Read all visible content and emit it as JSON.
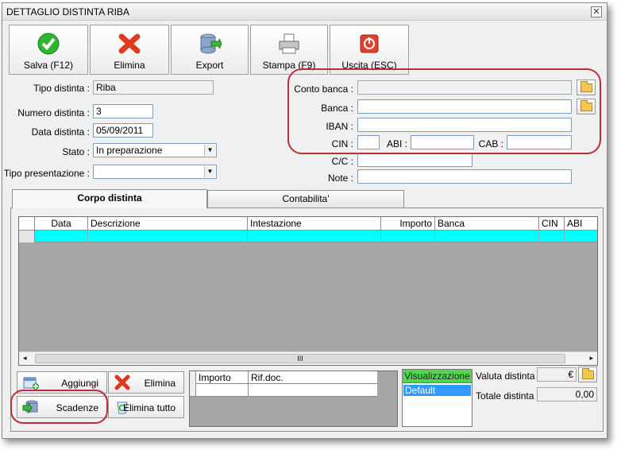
{
  "window": {
    "title": "DETTAGLIO DISTINTA RIBA",
    "close_glyph": "✕"
  },
  "toolbar": [
    {
      "label": "Salva (F12)",
      "icon": "check-icon"
    },
    {
      "label": "Elimina",
      "icon": "red-x-icon"
    },
    {
      "label": "Export",
      "icon": "export-icon"
    },
    {
      "label": "Stampa (F9)",
      "icon": "printer-icon"
    },
    {
      "label": "Uscita (ESC)",
      "icon": "power-icon"
    }
  ],
  "left_form": {
    "tipo_distinta": {
      "label": "Tipo distinta :",
      "value": "Riba"
    },
    "numero_distinta": {
      "label": "Numero distinta :",
      "value": "3"
    },
    "data_distinta": {
      "label": "Data distinta :",
      "value": "05/09/2011"
    },
    "stato": {
      "label": "Stato :",
      "value": "In preparazione"
    },
    "tipo_presentazione": {
      "label": "Tipo presentazione :",
      "value": ""
    }
  },
  "right_form": {
    "conto_banca": {
      "label": "Conto banca :",
      "value": ""
    },
    "banca": {
      "label": "Banca :",
      "value": ""
    },
    "iban": {
      "label": "IBAN :",
      "value": ""
    },
    "cin": {
      "label": "CIN :",
      "value": ""
    },
    "abi": {
      "label": "ABI :",
      "value": ""
    },
    "cab": {
      "label": "CAB :",
      "value": ""
    },
    "cc": {
      "label": "C/C :",
      "value": ""
    },
    "note": {
      "label": "Note :",
      "value": ""
    }
  },
  "tabs": [
    {
      "label": "Corpo distinta",
      "active": true
    },
    {
      "label": "Contabilita'",
      "active": false
    }
  ],
  "grid": {
    "columns": [
      "Data",
      "Descrizione",
      "Intestazione",
      "Importo",
      "Banca",
      "CIN",
      "ABI"
    ],
    "selected_row_color": "#00ffff",
    "scroll_thumb": "III"
  },
  "bottom_buttons": {
    "aggiungi": "Aggiungi",
    "elimina": "Elimina",
    "scadenze": "Scadenze",
    "elimina_tutto": "Elimina tutto"
  },
  "mini_grid": {
    "columns": [
      "Importo",
      "Rif.doc."
    ]
  },
  "visualizzazione": {
    "header": "Visualizzazione",
    "items": [
      "Default"
    ]
  },
  "totals": {
    "valuta_label": "Valuta distinta :",
    "valuta_value": "€",
    "totale_label": "Totale distinta :",
    "totale_value": "0,00"
  },
  "colors": {
    "highlight_ring": "#b9303a",
    "selection_blue": "#3399ff",
    "vis_header_green": "#52d652"
  }
}
